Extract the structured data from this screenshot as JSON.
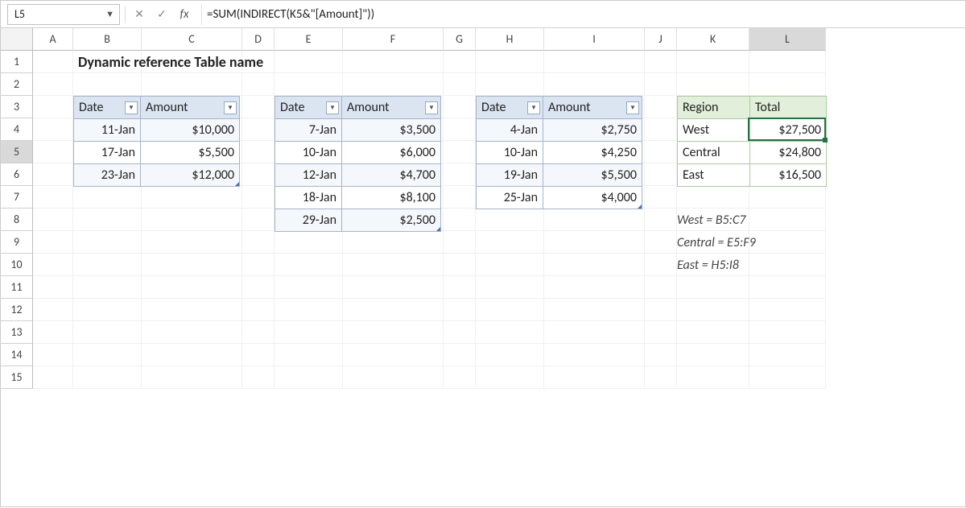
{
  "formula_bar": {
    "cell_ref": "L5",
    "fx_label": "fx",
    "formula": "=SUM(INDIRECT(K5&\"[Amount]\"))"
  },
  "columns": [
    "A",
    "B",
    "C",
    "D",
    "E",
    "F",
    "G",
    "H",
    "I",
    "J",
    "K",
    "L"
  ],
  "row_count": 15,
  "title": "Dynamic reference Table name",
  "tables": {
    "west": {
      "headers": [
        "Date",
        "Amount"
      ],
      "rows": [
        [
          "11-Jan",
          "$10,000"
        ],
        [
          "17-Jan",
          "$5,500"
        ],
        [
          "23-Jan",
          "$12,000"
        ]
      ]
    },
    "central": {
      "headers": [
        "Date",
        "Amount"
      ],
      "rows": [
        [
          "7-Jan",
          "$3,500"
        ],
        [
          "10-Jan",
          "$6,000"
        ],
        [
          "12-Jan",
          "$4,700"
        ],
        [
          "18-Jan",
          "$8,100"
        ],
        [
          "29-Jan",
          "$2,500"
        ]
      ]
    },
    "east": {
      "headers": [
        "Date",
        "Amount"
      ],
      "rows": [
        [
          "4-Jan",
          "$2,750"
        ],
        [
          "10-Jan",
          "$4,250"
        ],
        [
          "19-Jan",
          "$5,500"
        ],
        [
          "25-Jan",
          "$4,000"
        ]
      ]
    }
  },
  "summary": {
    "headers": [
      "Region",
      "Total"
    ],
    "rows": [
      [
        "West",
        "$27,500"
      ],
      [
        "Central",
        "$24,800"
      ],
      [
        "East",
        "$16,500"
      ]
    ]
  },
  "notes": [
    "West = B5:C7",
    "Central = E5:F9",
    "East = H5:I8"
  ],
  "active_column": "L",
  "active_row": 5
}
